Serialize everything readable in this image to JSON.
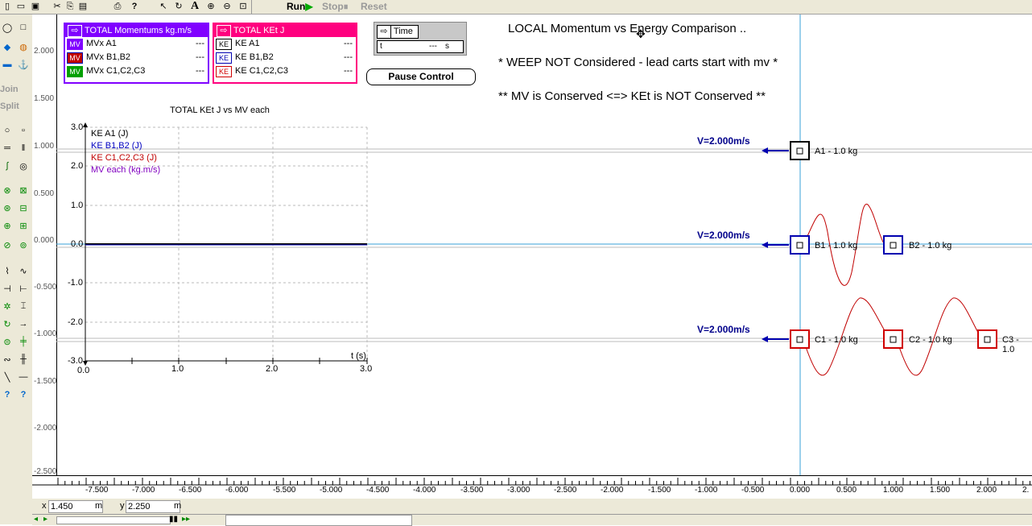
{
  "toolbar": {
    "run_label": "Run",
    "stop_label": "Stop",
    "reset_label": "Reset"
  },
  "palette": {
    "join_label": "Join",
    "split_label": "Split"
  },
  "momentum_meter": {
    "title": "TOTAL Momentums kg.m/s",
    "color": "#8000ff",
    "rows": [
      {
        "tag": "MV",
        "name": "MVx A1",
        "value": "---"
      },
      {
        "tag": "MV",
        "name": "MVx B1,B2",
        "value": "---"
      },
      {
        "tag": "MV",
        "name": "MVx C1,C2,C3",
        "value": "---"
      }
    ]
  },
  "ke_meter": {
    "title": "TOTAL KEt J",
    "color": "#ff007f",
    "rows": [
      {
        "tag": "KE",
        "name": "KE A1",
        "value": "---"
      },
      {
        "tag": "KE",
        "name": "KE B1,B2",
        "value": "---"
      },
      {
        "tag": "KE",
        "name": "KE C1,C2,C3",
        "value": "---"
      }
    ]
  },
  "time_meter": {
    "title": "Time",
    "var": "t",
    "value": "---",
    "unit": "s"
  },
  "pause_button": "Pause Control",
  "notes": {
    "line1": "LOCAL Momentum vs Energy Comparison ..",
    "line2": "* WEEP NOT Considered - lead carts start with mv *",
    "line3": "** MV is Conserved <=> KEt is NOT Conserved **"
  },
  "graph": {
    "title": "TOTAL KEt J vs MV each",
    "legend": [
      {
        "label": "KE A1 (J)",
        "color": "#000000"
      },
      {
        "label": "KE B1,B2 (J)",
        "color": "#0000c0"
      },
      {
        "label": "KE C1,C2,C3 (J)",
        "color": "#c00000"
      },
      {
        "label": "MV each (kg.m/s)",
        "color": "#8000c0"
      }
    ],
    "y_ticks": [
      "3.0",
      "2.0",
      "1.0",
      "0.0",
      "-1.0",
      "-2.0",
      "-3.0"
    ],
    "x_ticks": [
      "0.0",
      "1.0",
      "2.0",
      "3.0"
    ],
    "x_axis_label": "t (s)"
  },
  "velocities": {
    "a": "V=2.000m/s",
    "b": "V=2.000m/s",
    "c": "V=2.000m/s"
  },
  "carts": {
    "a1": "A1 - 1.0 kg",
    "b1": "B1 - 1.0 kg",
    "b2": "B2 - 1.0 kg",
    "c1": "C1 - 1.0 kg",
    "c2": "C2 - 1.0 kg",
    "c3": "C3 - 1.0"
  },
  "vertical_ruler": [
    "2.000",
    "1.500",
    "1.000",
    "0.500",
    "0.000",
    "-0.500",
    "-1.000",
    "-1.500",
    "-2.000",
    "-2.500"
  ],
  "horizontal_ruler": [
    "-7.500",
    "-7.000",
    "-6.500",
    "-6.000",
    "-5.500",
    "-5.000",
    "-4.500",
    "-4.000",
    "-3.500",
    "-3.000",
    "-2.500",
    "-2.000",
    "-1.500",
    "-1.000",
    "-0.500",
    "0.000",
    "0.500",
    "1.000",
    "1.500",
    "2.000",
    "2."
  ],
  "status": {
    "x_label": "x",
    "x_value": "1.450",
    "x_unit": "m",
    "y_label": "y",
    "y_value": "2.250",
    "y_unit": "m"
  },
  "colors": {
    "cart_a": "#000000",
    "cart_b": "#0000b0",
    "cart_c": "#d00000",
    "spring": "#c00000",
    "arrow": "#0000b0",
    "origin_line": "#3aa0d8"
  }
}
